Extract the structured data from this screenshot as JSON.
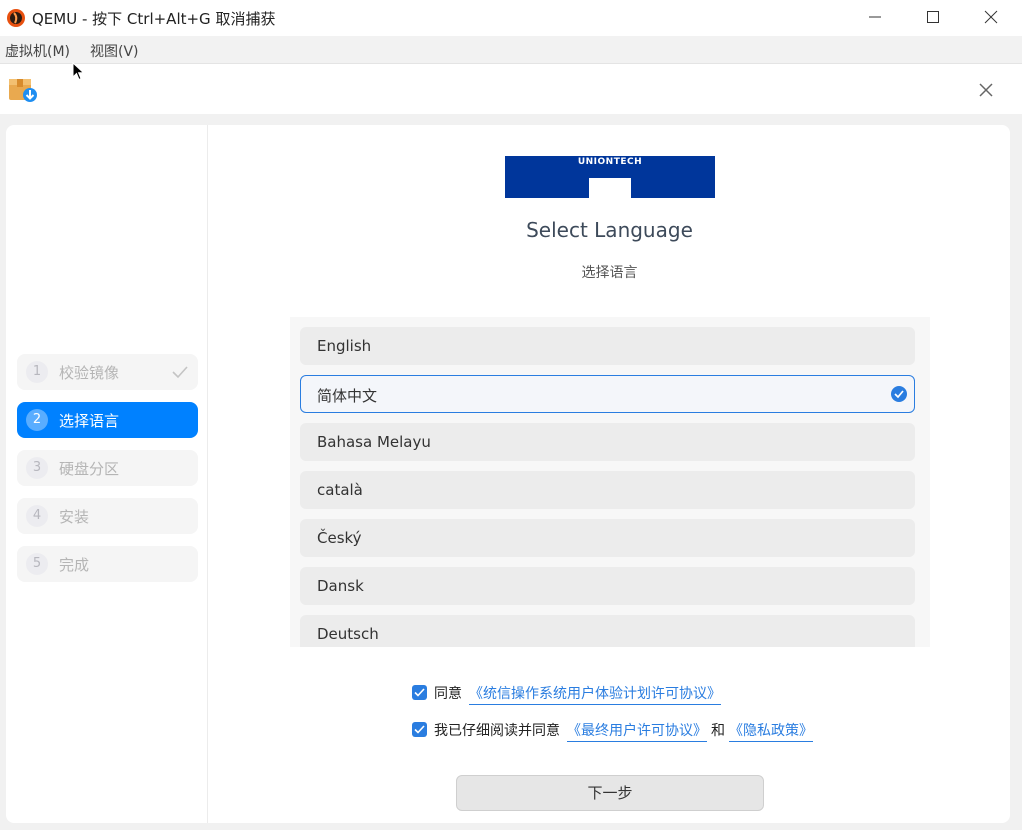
{
  "window": {
    "title": "QEMU - 按下 Ctrl+Alt+G 取消捕获",
    "minimize_icon": "minimize-icon",
    "maximize_icon": "maximize-icon",
    "close_icon": "close-icon"
  },
  "menubar": {
    "items": [
      {
        "label": "虚拟机(M)"
      },
      {
        "label": "视图(V)"
      }
    ]
  },
  "installer": {
    "app_icon": "installer-package-icon",
    "close_icon": "close-icon",
    "accent_color": "#0081ff",
    "logo_text": "UNIONTECH",
    "logo_color": "#00369b"
  },
  "sidebar": {
    "steps": [
      {
        "num": "1",
        "label": "校验镜像",
        "state": "done"
      },
      {
        "num": "2",
        "label": "选择语言",
        "state": "active"
      },
      {
        "num": "3",
        "label": "硬盘分区",
        "state": "pending"
      },
      {
        "num": "4",
        "label": "安装",
        "state": "pending"
      },
      {
        "num": "5",
        "label": "完成",
        "state": "pending"
      }
    ]
  },
  "main": {
    "heading": "Select Language",
    "subheading": "选择语言",
    "languages": [
      {
        "name": "English",
        "selected": false
      },
      {
        "name": "简体中文",
        "selected": true
      },
      {
        "name": "Bahasa Melayu",
        "selected": false
      },
      {
        "name": "català",
        "selected": false
      },
      {
        "name": "Český",
        "selected": false
      },
      {
        "name": "Dansk",
        "selected": false
      },
      {
        "name": "Deutsch",
        "selected": false
      }
    ],
    "agreements": [
      {
        "checked": true,
        "prefix": "同意",
        "link1": "《统信操作系统用户体验计划许可协议》"
      },
      {
        "checked": true,
        "prefix": "我已仔细阅读并同意",
        "link1": "《最终用户许可协议》",
        "joiner": "和",
        "link2": "《隐私政策》"
      }
    ],
    "next_label": "下一步"
  }
}
